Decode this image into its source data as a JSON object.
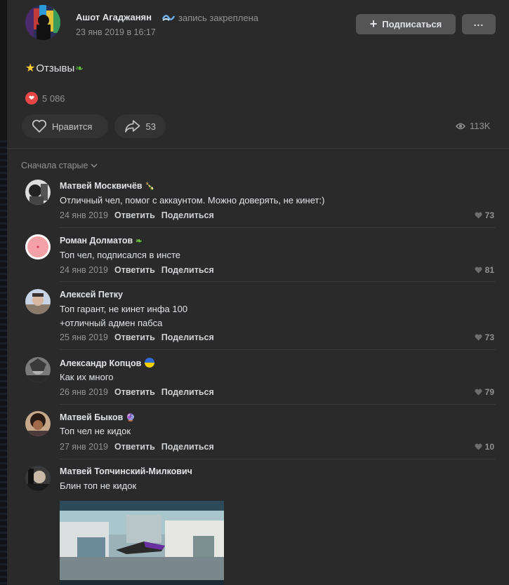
{
  "post": {
    "author": "Ашот Агаджанян",
    "pinned_label": "запись закреплена",
    "date": "23 янв 2019 в 16:17",
    "subscribe_label": "Подписаться",
    "more_label": "...",
    "text": "Отзывы",
    "reaction_count": "5 086",
    "like_label": "Нравится",
    "share_count": "53",
    "views": "113K"
  },
  "comments_header": {
    "sort_label": "Сначала старые"
  },
  "comments": [
    {
      "name": "Матвей Москвичёв",
      "text": "Отличный чел, помог с аккаунтом. Можно доверять, не кинет:)",
      "date": "24 янв 2019",
      "reply": "Ответить",
      "share": "Поделиться",
      "likes": "73"
    },
    {
      "name": "Роман Долматов",
      "text": "Топ чел, подписался в инсте",
      "date": "24 янв 2019",
      "reply": "Ответить",
      "share": "Поделиться",
      "likes": "81"
    },
    {
      "name": "Алексей Петку",
      "text_line1": "Топ гарант, не кинет инфа 100",
      "text_line2": "+отличный адмен пабса",
      "date": "25 янв 2019",
      "reply": "Ответить",
      "share": "Поделиться",
      "likes": "73"
    },
    {
      "name": "Александр Копцов",
      "text": "Как их много",
      "date": "26 янв 2019",
      "reply": "Ответить",
      "share": "Поделиться",
      "likes": "79"
    },
    {
      "name": "Матвей Быков",
      "text": "Топ чел не кидок",
      "date": "27 янв 2019",
      "reply": "Ответить",
      "share": "Поделиться",
      "likes": "10"
    },
    {
      "name": "Матвей Топчинский-Милкович",
      "text": "Блин топ не кидок"
    }
  ],
  "colors": {
    "background": "#2a2a2b",
    "button": "#555555",
    "secondary_text": "#939393",
    "reaction_red": "#e64646"
  }
}
